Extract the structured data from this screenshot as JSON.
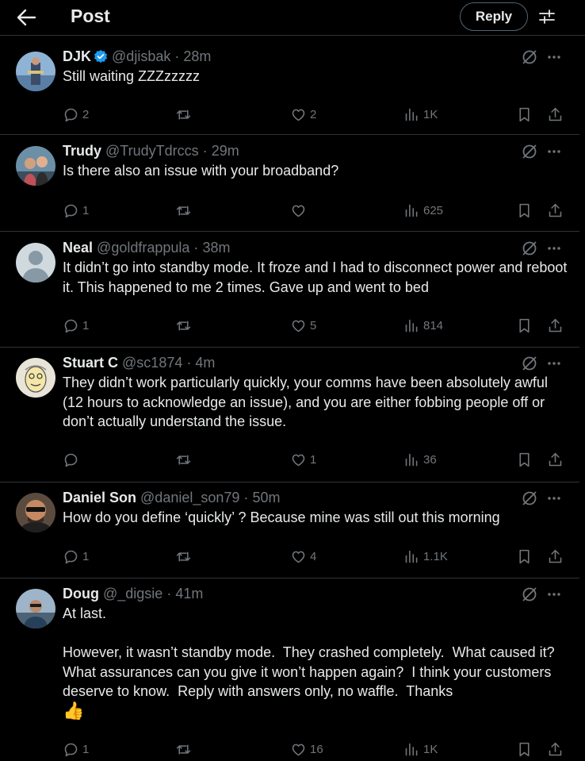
{
  "header": {
    "title": "Post",
    "reply_label": "Reply"
  },
  "colors": {
    "background": "#000000",
    "text": "#e7e9ea",
    "muted": "#71767b",
    "divider": "#2f3336",
    "verified": "#1d9bf0"
  },
  "icons": [
    "back-arrow-icon",
    "filter-icon",
    "verified-icon",
    "grok-icon",
    "more-icon",
    "reply-icon",
    "retweet-icon",
    "like-icon",
    "views-icon",
    "bookmark-icon",
    "share-icon",
    "thumbs-up-emoji"
  ],
  "tweets": [
    {
      "name": "DJK",
      "handle": "@djisbak",
      "dot": "·",
      "time": "28m",
      "verified": true,
      "text": "Still waiting ZZZzzzzz",
      "replies": "2",
      "retweets": "",
      "likes": "2",
      "views": "1K"
    },
    {
      "name": "Trudy",
      "handle": "@TrudyTdrccs",
      "dot": "·",
      "time": "29m",
      "verified": false,
      "text": "Is there also an issue with your broadband?",
      "replies": "1",
      "retweets": "",
      "likes": "",
      "views": "625"
    },
    {
      "name": "Neal",
      "handle": "@goldfrappula",
      "dot": "·",
      "time": "38m",
      "verified": false,
      "text": "It didn’t go into standby mode. It froze and I had to disconnect power and reboot it. This happened to me 2 times. Gave up and went to bed",
      "replies": "1",
      "retweets": "",
      "likes": "5",
      "views": "814"
    },
    {
      "name": "Stuart C",
      "handle": "@sc1874",
      "dot": "·",
      "time": "4m",
      "verified": false,
      "text": "They didn’t work particularly quickly, your comms have been absolutely awful (12 hours to acknowledge an issue), and you are either fobbing people off or don’t actually understand the issue.",
      "replies": "",
      "retweets": "",
      "likes": "1",
      "views": "36"
    },
    {
      "name": "Daniel Son",
      "handle": "@daniel_son79",
      "dot": "·",
      "time": "50m",
      "verified": false,
      "text": "How do you define ‘quickly’ ? Because mine was still out this morning",
      "replies": "1",
      "retweets": "",
      "likes": "4",
      "views": "1.1K"
    },
    {
      "name": "Doug",
      "handle": "@_digsie",
      "dot": "·",
      "time": "41m",
      "verified": false,
      "text": "At last.\n\nHowever, it wasn’t standby mode.  They crashed completely.  What caused it?  What assurances can you give it won’t happen again?  I think your customers deserve to know.  Reply with answers only, no waffle.  Thanks",
      "emoji": "👍",
      "replies": "1",
      "retweets": "",
      "likes": "16",
      "views": "1K"
    }
  ]
}
